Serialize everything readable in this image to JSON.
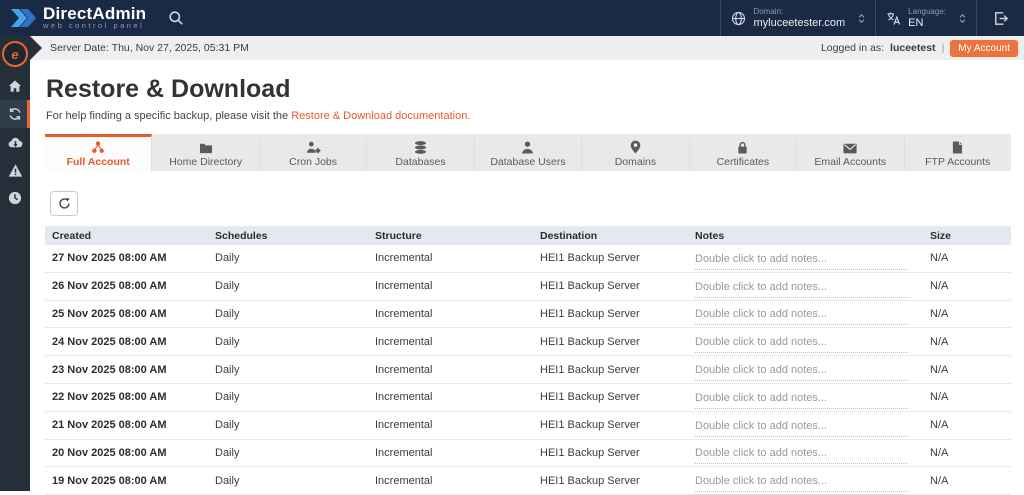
{
  "topbar": {
    "brand": {
      "name": "DirectAdmin",
      "tagline": "web control panel"
    },
    "domain": {
      "label": "Domain:",
      "value": "myluceetester.com"
    },
    "language": {
      "label": "Language:",
      "value": "EN"
    }
  },
  "statusbar": {
    "server_date": "Server Date: Thu, Nov 27, 2025, 05:31 PM",
    "logged_in_prefix": "Logged in as:",
    "username": "luceetest",
    "separator": "|",
    "my_account_label": "My Account"
  },
  "sidebar": {
    "avatar_glyph": "e",
    "items": [
      {
        "name": "home"
      },
      {
        "name": "restore",
        "active": true
      },
      {
        "name": "backups"
      },
      {
        "name": "alerts"
      },
      {
        "name": "history"
      }
    ]
  },
  "page": {
    "title": "Restore & Download",
    "help_text": "For help finding a specific backup, please visit the ",
    "help_link": "Restore & Download documentation."
  },
  "tabs": [
    {
      "label": "Full Account",
      "active": true
    },
    {
      "label": "Home Directory"
    },
    {
      "label": "Cron Jobs"
    },
    {
      "label": "Databases"
    },
    {
      "label": "Database Users"
    },
    {
      "label": "Domains"
    },
    {
      "label": "Certificates"
    },
    {
      "label": "Email Accounts"
    },
    {
      "label": "FTP Accounts"
    }
  ],
  "table": {
    "columns": [
      "Created",
      "Schedules",
      "Structure",
      "Destination",
      "Notes",
      "Size"
    ],
    "rows": [
      {
        "created": "27 Nov 2025 08:00 AM",
        "schedules": "Daily",
        "structure": "Incremental",
        "destination": "HEI1 Backup Server",
        "notes": "Double click to add notes...",
        "size": "N/A"
      },
      {
        "created": "26 Nov 2025 08:00 AM",
        "schedules": "Daily",
        "structure": "Incremental",
        "destination": "HEI1 Backup Server",
        "notes": "Double click to add notes...",
        "size": "N/A"
      },
      {
        "created": "25 Nov 2025 08:00 AM",
        "schedules": "Daily",
        "structure": "Incremental",
        "destination": "HEI1 Backup Server",
        "notes": "Double click to add notes...",
        "size": "N/A"
      },
      {
        "created": "24 Nov 2025 08:00 AM",
        "schedules": "Daily",
        "structure": "Incremental",
        "destination": "HEI1 Backup Server",
        "notes": "Double click to add notes...",
        "size": "N/A"
      },
      {
        "created": "23 Nov 2025 08:00 AM",
        "schedules": "Daily",
        "structure": "Incremental",
        "destination": "HEI1 Backup Server",
        "notes": "Double click to add notes...",
        "size": "N/A"
      },
      {
        "created": "22 Nov 2025 08:00 AM",
        "schedules": "Daily",
        "structure": "Incremental",
        "destination": "HEI1 Backup Server",
        "notes": "Double click to add notes...",
        "size": "N/A"
      },
      {
        "created": "21 Nov 2025 08:00 AM",
        "schedules": "Daily",
        "structure": "Incremental",
        "destination": "HEI1 Backup Server",
        "notes": "Double click to add notes...",
        "size": "N/A"
      },
      {
        "created": "20 Nov 2025 08:00 AM",
        "schedules": "Daily",
        "structure": "Incremental",
        "destination": "HEI1 Backup Server",
        "notes": "Double click to add notes...",
        "size": "N/A"
      },
      {
        "created": "19 Nov 2025 08:00 AM",
        "schedules": "Daily",
        "structure": "Incremental",
        "destination": "HEI1 Backup Server",
        "notes": "Double click to add notes...",
        "size": "N/A"
      }
    ]
  },
  "colors": {
    "topbar_bg": "#1b2a44",
    "sidebar_bg": "#252f3a",
    "accent_orange": "#e8592b",
    "button_orange": "#ee7140",
    "table_header_bg": "#e4e9f1"
  }
}
